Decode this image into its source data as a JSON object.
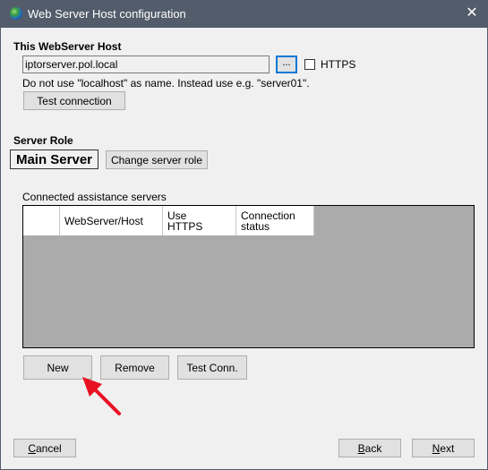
{
  "window": {
    "title": "Web Server Host configuration",
    "icon": "globe-icon",
    "close_icon": "close-icon"
  },
  "host_section": {
    "heading": "This WebServer Host",
    "host_value": "iptorserver.pol.local",
    "browse_label": "...",
    "https_label": "HTTPS",
    "https_checked": false,
    "hint": "Do not use \"localhost\" as name. Instead use e.g. \"server01\".",
    "test_connection_label": "Test connection"
  },
  "role_section": {
    "heading": "Server Role",
    "role_value": "Main Server",
    "change_role_label": "Change server role"
  },
  "assist_section": {
    "label": "Connected assistance servers",
    "columns": [
      "",
      "WebServer/Host",
      "Use HTTPS",
      "Connection status"
    ],
    "rows": [],
    "new_label": "New",
    "remove_label": "Remove",
    "test_conn_label": "Test Conn."
  },
  "footer": {
    "cancel_label": "Cancel",
    "back_label": "Back",
    "next_label": "Next"
  },
  "annotation": {
    "arrow_color": "#e81123",
    "points_to": "New"
  }
}
